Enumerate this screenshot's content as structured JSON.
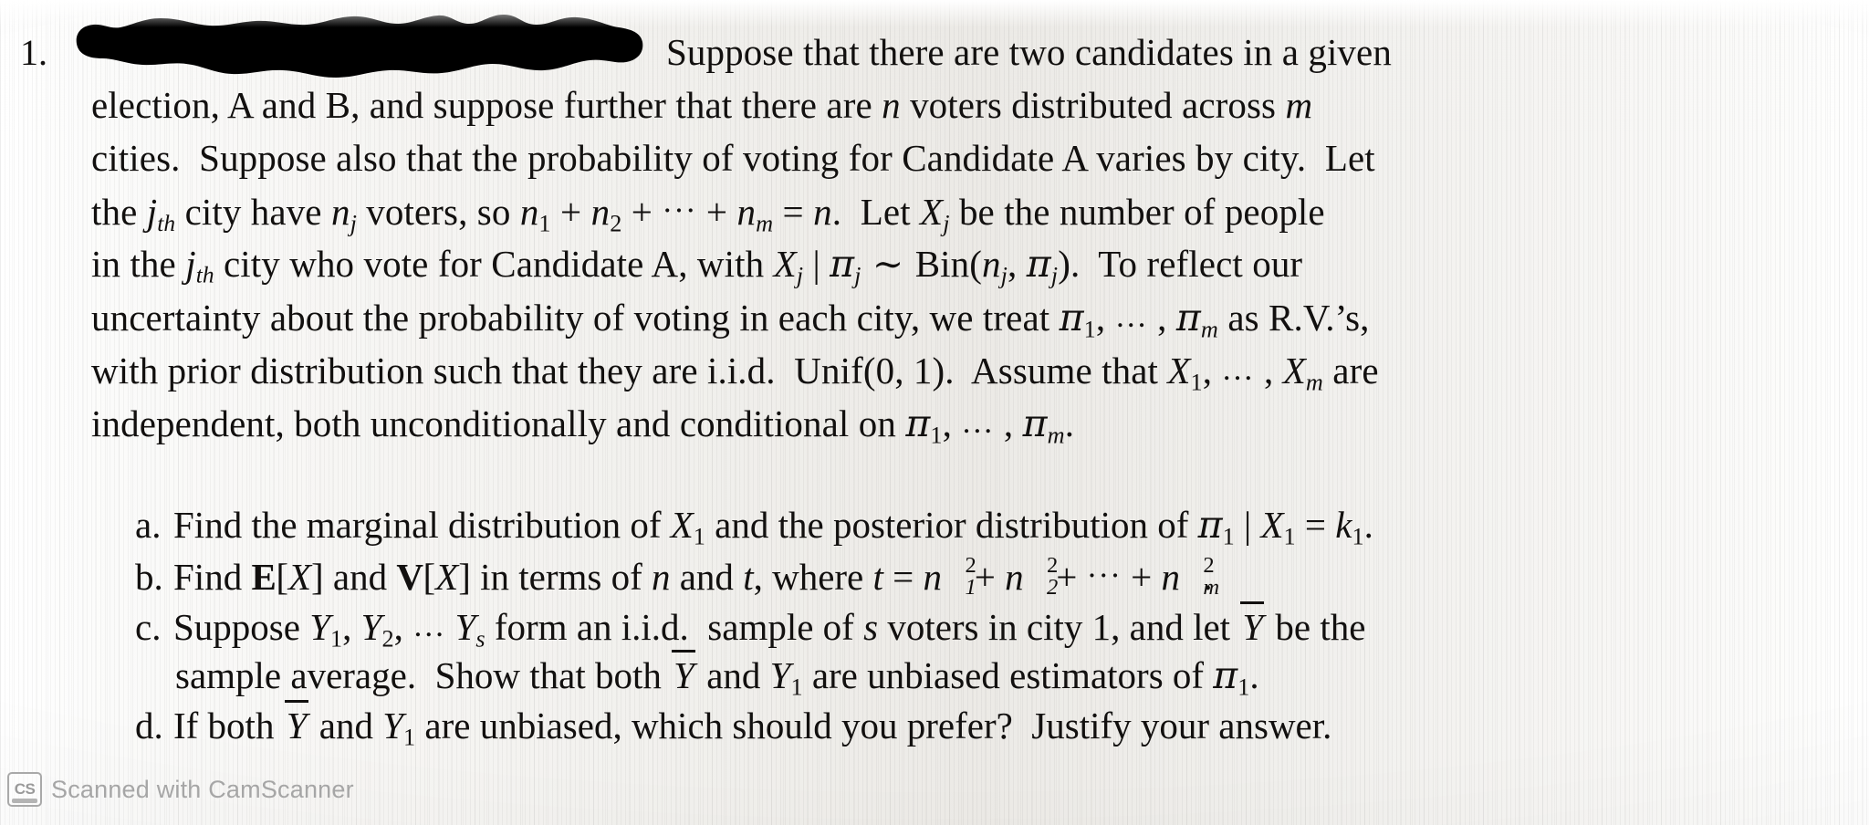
{
  "document": {
    "kind": "scanned-homework-page",
    "question_number": "1.",
    "redaction": {
      "present": true,
      "color": "#000000",
      "description": "black marker redaction bar covering the opening phrase"
    }
  },
  "paragraph": {
    "lines": [
      {
        "id": "l1",
        "segments": [
          {
            "t": "redaction",
            "v": ""
          },
          {
            "t": "text",
            "v": "Suppose that there are two candidates in a given"
          }
        ]
      },
      {
        "id": "l2",
        "segments": [
          {
            "t": "text",
            "v": "election, A and B, and suppose further that there are "
          },
          {
            "t": "mi",
            "v": "n"
          },
          {
            "t": "text",
            "v": " voters distributed across "
          },
          {
            "t": "mi",
            "v": "m"
          }
        ]
      },
      {
        "id": "l3",
        "segments": [
          {
            "t": "text",
            "v": "cities.  Suppose also that the probability of voting for Candidate A varies by city.  Let"
          }
        ]
      },
      {
        "id": "l4",
        "segments": [
          {
            "t": "text",
            "v": "the "
          },
          {
            "t": "ord",
            "v": "j",
            "sub": "th"
          },
          {
            "t": "text",
            "v": " city have "
          },
          {
            "t": "mi",
            "v": "n",
            "sub": "j"
          },
          {
            "t": "text",
            "v": " voters, so "
          },
          {
            "t": "mi",
            "v": "n",
            "sub": "1"
          },
          {
            "t": "text",
            "v": " + "
          },
          {
            "t": "mi",
            "v": "n",
            "sub": "2"
          },
          {
            "t": "text",
            "v": " + ··· + "
          },
          {
            "t": "mi",
            "v": "n",
            "sub": "m"
          },
          {
            "t": "text",
            "v": " = "
          },
          {
            "t": "mi",
            "v": "n"
          },
          {
            "t": "text",
            "v": ".  Let "
          },
          {
            "t": "mi",
            "v": "X",
            "sub": "j"
          },
          {
            "t": "text",
            "v": " be the number of people"
          }
        ]
      },
      {
        "id": "l5",
        "segments": [
          {
            "t": "text",
            "v": "in the "
          },
          {
            "t": "ord",
            "v": "j",
            "sub": "th"
          },
          {
            "t": "text",
            "v": " city who vote for Candidate A, with "
          },
          {
            "t": "mi",
            "v": "X",
            "sub": "j"
          },
          {
            "t": "text",
            "v": " | "
          },
          {
            "t": "pi",
            "v": "π",
            "sub": "j"
          },
          {
            "t": "text",
            "v": " ~ Bin("
          },
          {
            "t": "mi",
            "v": "n",
            "sub": "j"
          },
          {
            "t": "text",
            "v": ", "
          },
          {
            "t": "pi",
            "v": "π",
            "sub": "j"
          },
          {
            "t": "text",
            "v": ").  To reflect our"
          }
        ]
      },
      {
        "id": "l6",
        "segments": [
          {
            "t": "text",
            "v": "uncertainty about the probability of voting in each city, we treat "
          },
          {
            "t": "pi",
            "v": "π",
            "sub": "1"
          },
          {
            "t": "text",
            "v": ", … , "
          },
          {
            "t": "pi",
            "v": "π",
            "sub": "m"
          },
          {
            "t": "text",
            "v": " as R.V.’s,"
          }
        ]
      },
      {
        "id": "l7",
        "segments": [
          {
            "t": "text",
            "v": "with prior distribution such that they are i.i.d.  Unif(0, 1).  Assume that "
          },
          {
            "t": "mi",
            "v": "X",
            "sub": "1"
          },
          {
            "t": "text",
            "v": ", … , "
          },
          {
            "t": "mi",
            "v": "X",
            "sub": "m"
          },
          {
            "t": "text",
            "v": " are"
          }
        ]
      },
      {
        "id": "l8",
        "segments": [
          {
            "t": "text",
            "v": "independent, both unconditionally and conditional on "
          },
          {
            "t": "pi",
            "v": "π",
            "sub": "1"
          },
          {
            "t": "text",
            "v": ", … , "
          },
          {
            "t": "pi",
            "v": "π",
            "sub": "m"
          },
          {
            "t": "text",
            "v": "."
          }
        ]
      }
    ],
    "plain_text": "1. [REDACTED] Suppose that there are two candidates in a given election, A and B, and suppose further that there are n voters distributed across m cities. Suppose also that the probability of voting for Candidate A varies by city. Let the jth city have n_j voters, so n_1 + n_2 + ... + n_m = n. Let X_j be the number of people in the jth city who vote for Candidate A, with X_j | π_j ~ Bin(n_j, π_j). To reflect our uncertainty about the probability of voting in each city, we treat π_1, ..., π_m as R.V.'s, with prior distribution such that they are i.i.d. Unif(0,1). Assume that X_1, ..., X_m are independent, both unconditionally and conditional on π_1, ..., π_m."
  },
  "subquestions": [
    {
      "label": "a.",
      "plain_text": "Find the marginal distribution of X_1 and the posterior distribution of π_1 | X_1 = k_1.",
      "lines": [
        [
          {
            "t": "text",
            "v": "Find the marginal distribution of "
          },
          {
            "t": "mi",
            "v": "X",
            "sub": "1"
          },
          {
            "t": "text",
            "v": " and the posterior distribution of "
          },
          {
            "t": "pi",
            "v": "π",
            "sub": "1"
          },
          {
            "t": "text",
            "v": " | "
          },
          {
            "t": "mi",
            "v": "X",
            "sub": "1"
          },
          {
            "t": "text",
            "v": " = "
          },
          {
            "t": "mi",
            "v": "k",
            "sub": "1"
          },
          {
            "t": "text",
            "v": "."
          }
        ]
      ]
    },
    {
      "label": "b.",
      "plain_text": "Find E[X] and V[X] in terms of n and t, where t = n_1^2 + n_2^2 + ... + n_m^2.",
      "lines": [
        [
          {
            "t": "text",
            "v": "Find "
          },
          {
            "t": "bb",
            "v": "E"
          },
          {
            "t": "text",
            "v": "["
          },
          {
            "t": "mi",
            "v": "X"
          },
          {
            "t": "text",
            "v": "] and "
          },
          {
            "t": "bb",
            "v": "V"
          },
          {
            "t": "text",
            "v": "["
          },
          {
            "t": "mi",
            "v": "X"
          },
          {
            "t": "text",
            "v": "] in terms of "
          },
          {
            "t": "mi",
            "v": "n"
          },
          {
            "t": "text",
            "v": " and "
          },
          {
            "t": "mi",
            "v": "t"
          },
          {
            "t": "text",
            "v": ", where "
          },
          {
            "t": "mi",
            "v": "t"
          },
          {
            "t": "text",
            "v": " = "
          },
          {
            "t": "nsq",
            "v": "n",
            "sup": "2",
            "sub": "1"
          },
          {
            "t": "text",
            "v": " + "
          },
          {
            "t": "nsq",
            "v": "n",
            "sup": "2",
            "sub": "2"
          },
          {
            "t": "text",
            "v": " + ··· + "
          },
          {
            "t": "nsq",
            "v": "n",
            "sup": "2",
            "sub": "m"
          },
          {
            "t": "text",
            "v": "."
          }
        ]
      ]
    },
    {
      "label": "c.",
      "plain_text": "Suppose Y_1, Y_2, ... Y_s form an i.i.d. sample of s voters in city 1, and let Ȳ be the sample average. Show that both Ȳ and Y_1 are unbiased estimators of π_1.",
      "lines": [
        [
          {
            "t": "text",
            "v": "Suppose "
          },
          {
            "t": "mi",
            "v": "Y",
            "sub": "1"
          },
          {
            "t": "text",
            "v": ", "
          },
          {
            "t": "mi",
            "v": "Y",
            "sub": "2"
          },
          {
            "t": "text",
            "v": ", … "
          },
          {
            "t": "mi",
            "v": "Y",
            "sub": "s"
          },
          {
            "t": "text",
            "v": " form an i.i.d.  sample of "
          },
          {
            "t": "mi",
            "v": "s"
          },
          {
            "t": "text",
            "v": " voters in city 1, and let "
          },
          {
            "t": "ovl",
            "v": "Y"
          },
          {
            "t": "text",
            "v": " be the"
          }
        ],
        [
          {
            "t": "text",
            "v": "sample average.  Show that both "
          },
          {
            "t": "ovl",
            "v": "Y"
          },
          {
            "t": "text",
            "v": " and "
          },
          {
            "t": "mi",
            "v": "Y",
            "sub": "1"
          },
          {
            "t": "text",
            "v": " are unbiased estimators of "
          },
          {
            "t": "pi",
            "v": "π",
            "sub": "1"
          },
          {
            "t": "text",
            "v": "."
          }
        ]
      ]
    },
    {
      "label": "d.",
      "plain_text": "If both Ȳ and Y_1 are unbiased, which should you prefer? Justify your answer.",
      "lines": [
        [
          {
            "t": "text",
            "v": "If both "
          },
          {
            "t": "ovl",
            "v": "Y"
          },
          {
            "t": "text",
            "v": " and "
          },
          {
            "t": "mi",
            "v": "Y",
            "sub": "1"
          },
          {
            "t": "text",
            "v": " are unbiased, which should you prefer?  Justify your answer."
          }
        ]
      ]
    }
  ],
  "watermark": {
    "badge_label": "CS",
    "text": "Scanned with CamScanner",
    "color": "#a6a6a6"
  }
}
